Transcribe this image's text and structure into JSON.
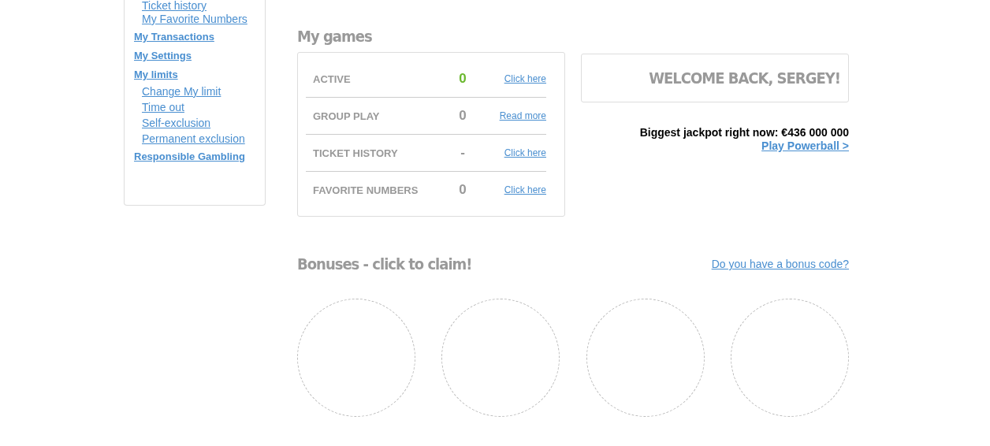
{
  "sidebar": {
    "items": [
      {
        "label": "Ticket history",
        "kind": "sub"
      },
      {
        "label": "My Favorite Numbers",
        "kind": "sub"
      },
      {
        "label": "My Transactions",
        "kind": "main"
      },
      {
        "label": "My Settings",
        "kind": "main"
      },
      {
        "label": "My limits",
        "kind": "main"
      },
      {
        "label": "Change My limit",
        "kind": "sub"
      },
      {
        "label": "Time out",
        "kind": "sub"
      },
      {
        "label": "Self-exclusion",
        "kind": "sub"
      },
      {
        "label": "Permanent exclusion",
        "kind": "sub"
      },
      {
        "label": "Responsible Gambling",
        "kind": "main"
      }
    ]
  },
  "my_games": {
    "title": "My games",
    "rows": [
      {
        "label": "ACTIVE",
        "count": "0",
        "highlight": true,
        "link": "Click here"
      },
      {
        "label": "GROUP PLAY",
        "count": "0",
        "highlight": false,
        "link": "Read more"
      },
      {
        "label": "TICKET HISTORY",
        "count": "-",
        "highlight": false,
        "link": "Click here"
      },
      {
        "label": "FAVORITE NUMBERS",
        "count": "0",
        "highlight": false,
        "link": "Click here"
      }
    ]
  },
  "welcome": "WELCOME BACK, SERGEY!",
  "jackpot": {
    "text": "Biggest jackpot right now: €436 000 000",
    "link": "Play Powerball >"
  },
  "bonuses": {
    "title": "Bonuses - click to claim!",
    "code_link": "Do you have a bonus code?"
  }
}
